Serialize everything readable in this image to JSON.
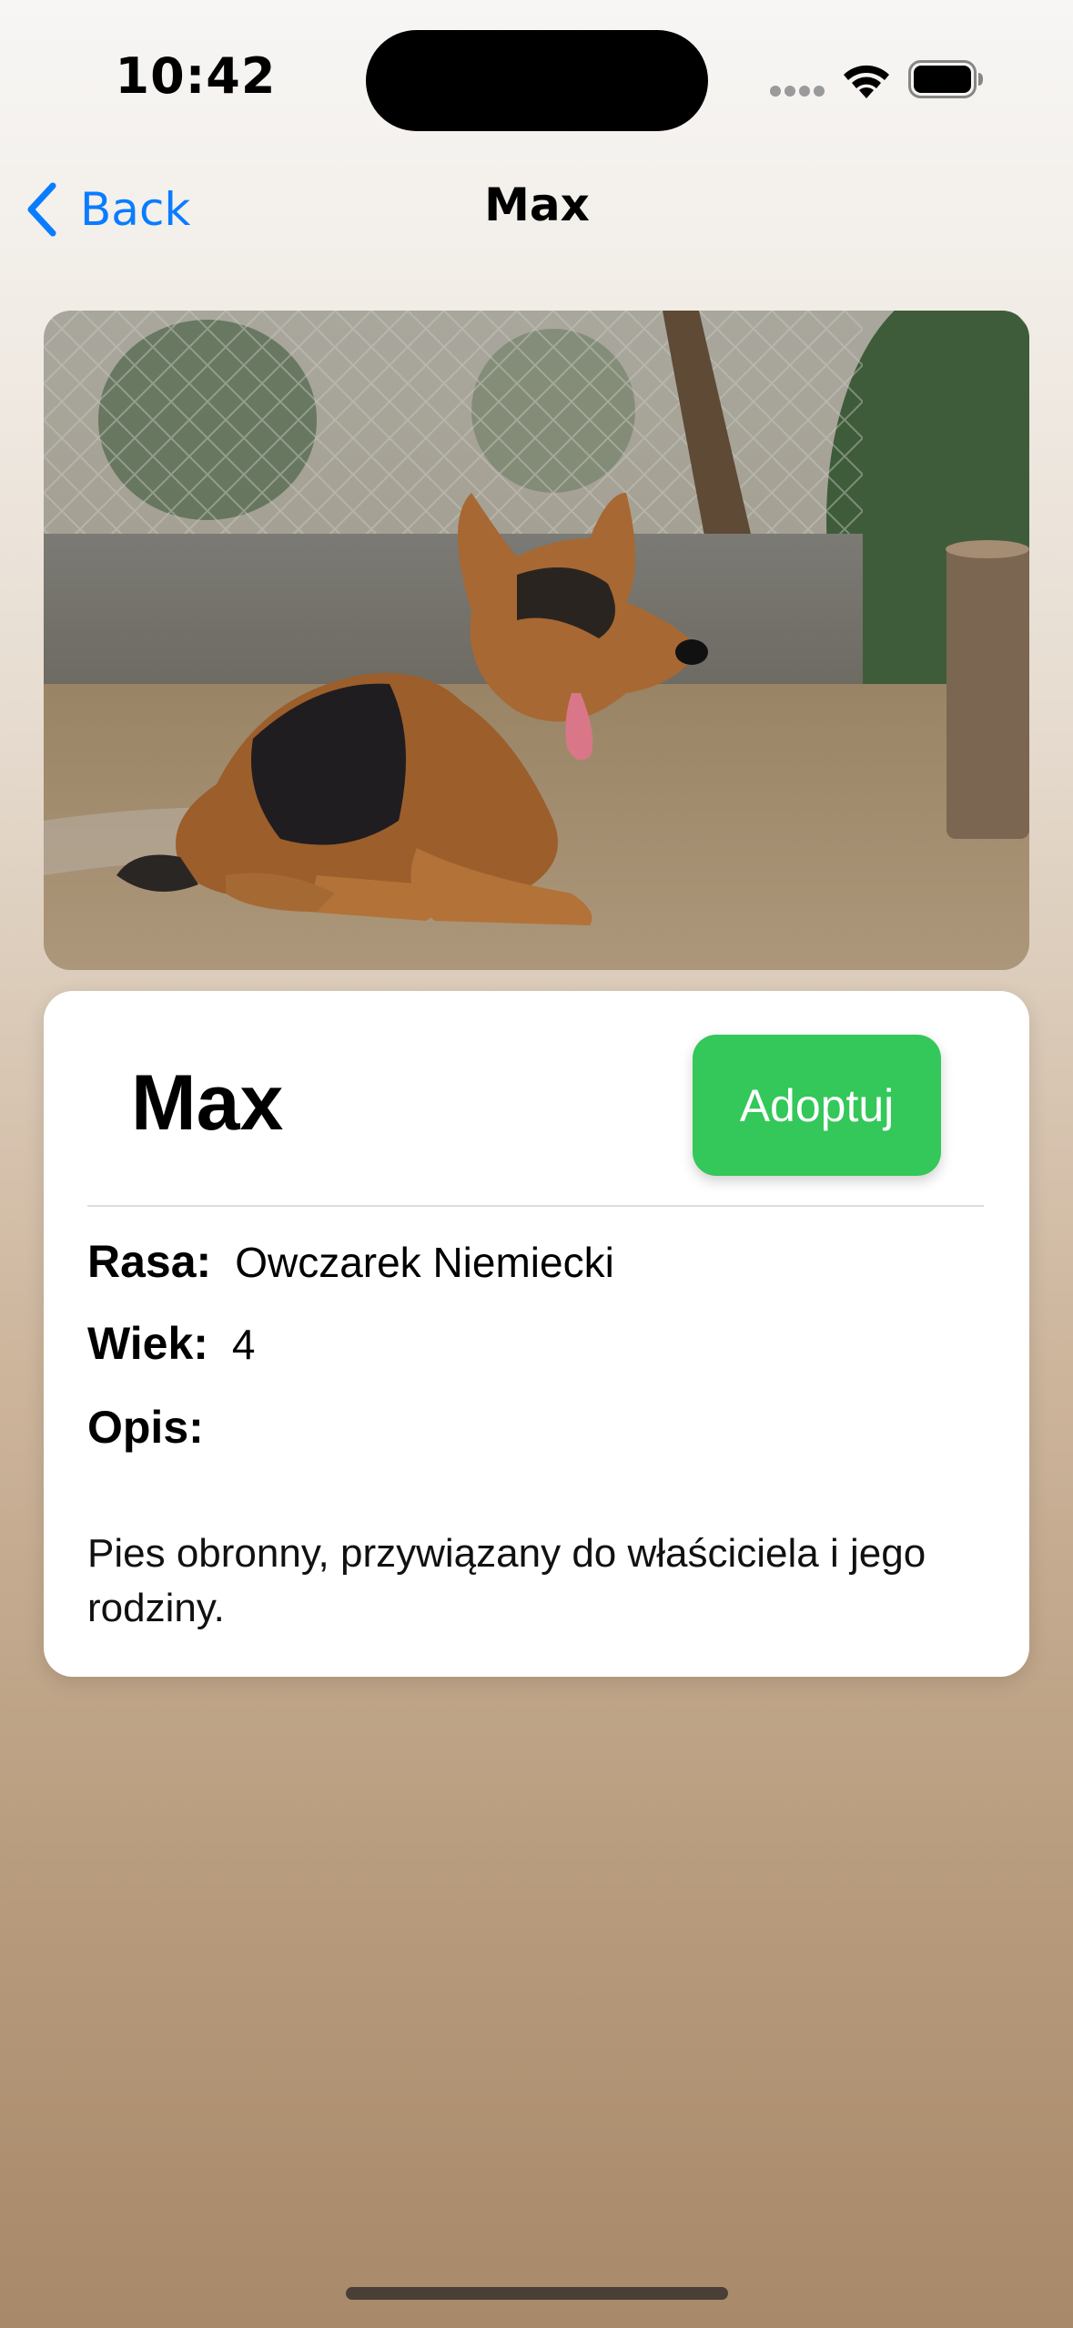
{
  "status_bar": {
    "time": "10:42",
    "icons": [
      "signal-icon",
      "wifi-icon",
      "battery-icon"
    ]
  },
  "nav": {
    "back_label": "Back",
    "title": "Max",
    "icon": "chevron-left-icon"
  },
  "photo": {
    "subject": "dog-photo"
  },
  "pet": {
    "name": "Max",
    "adopt_label": "Adoptuj",
    "fields": [
      {
        "key": "Rasa:",
        "value": "Owczarek Niemiecki"
      },
      {
        "key": "Wiek:",
        "value": "4"
      },
      {
        "key": "Opis:",
        "value": ""
      }
    ],
    "description": "Pies obronny, przywiązany do właściciela i jego rodziny."
  },
  "colors": {
    "accent": "#0a7cff",
    "adopt_button": "#34c759",
    "card": "#ffffff"
  }
}
